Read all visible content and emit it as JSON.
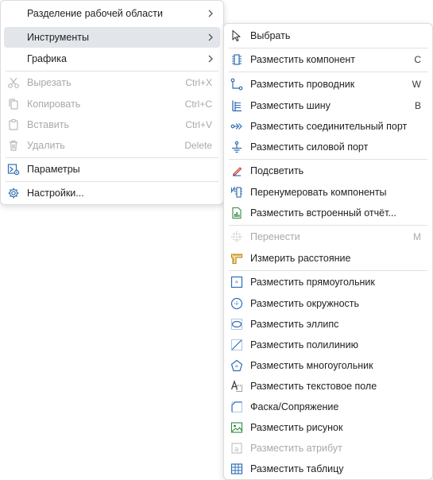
{
  "main_menu": {
    "items": [
      {
        "label": "Разделение рабочей области"
      },
      {
        "label": "Инструменты"
      },
      {
        "label": "Графика"
      },
      {
        "label": "Вырезать",
        "shortcut": "Ctrl+X"
      },
      {
        "label": "Копировать",
        "shortcut": "Ctrl+C"
      },
      {
        "label": "Вставить",
        "shortcut": "Ctrl+V"
      },
      {
        "label": "Удалить",
        "shortcut": "Delete"
      },
      {
        "label": "Параметры"
      },
      {
        "label": "Настройки..."
      }
    ]
  },
  "tools_menu": {
    "items": [
      {
        "label": "Выбрать"
      },
      {
        "label": "Разместить компонент",
        "shortcut": "C"
      },
      {
        "label": "Разместить проводник",
        "shortcut": "W"
      },
      {
        "label": "Разместить шину",
        "shortcut": "B"
      },
      {
        "label": "Разместить соединительный порт"
      },
      {
        "label": "Разместить силовой порт"
      },
      {
        "label": "Подсветить"
      },
      {
        "label": "Перенумеровать компоненты"
      },
      {
        "label": "Разместить встроенный отчёт..."
      },
      {
        "label": "Перенести",
        "shortcut": "M"
      },
      {
        "label": "Измерить расстояние"
      },
      {
        "label": "Разместить прямоугольник"
      },
      {
        "label": "Разместить окружность"
      },
      {
        "label": "Разместить эллипс"
      },
      {
        "label": "Разместить полилинию"
      },
      {
        "label": "Разместить многоугольник"
      },
      {
        "label": "Разместить текстовое поле"
      },
      {
        "label": "Фаска/Сопряжение"
      },
      {
        "label": "Разместить рисунок"
      },
      {
        "label": "Разместить атрибут"
      },
      {
        "label": "Разместить таблицу"
      }
    ]
  },
  "colors": {
    "icon": "#2f6db5",
    "icon_disabled": "#b9b9b9",
    "highlight": "#e2e6ea",
    "measure": "#c9a227",
    "report": "#2e8b3e",
    "highlight_tool": "#c0392b"
  }
}
